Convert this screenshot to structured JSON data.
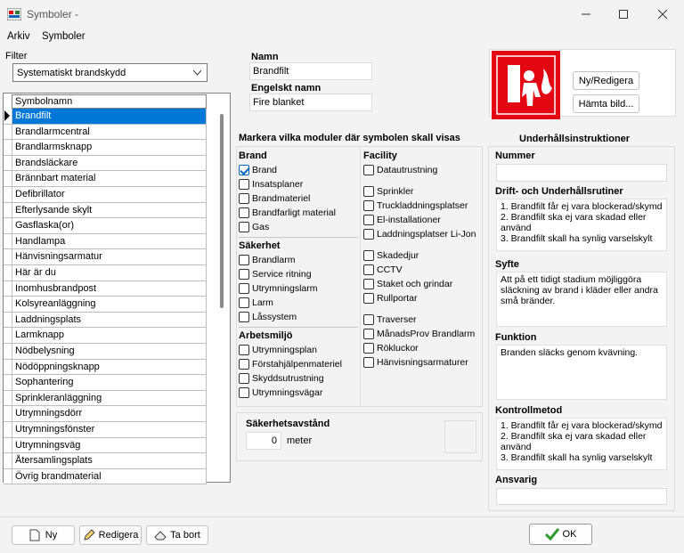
{
  "window": {
    "title": "Symboler -"
  },
  "menu": [
    "Arkiv",
    "Symboler"
  ],
  "filter": {
    "label": "Filter",
    "value": "Systematiskt brandskydd"
  },
  "list": {
    "header": "Symbolnamn",
    "items": [
      "Brandfilt",
      "Brandlarmcentral",
      "Brandlarmsknapp",
      "Brandsläckare",
      "Brännbart material",
      "Defibrillator",
      "Efterlysande skylt",
      "Gasflaska(or)",
      "Handlampa",
      "Hänvisningsarmatur",
      "Här är du",
      "Inomhusbrandpost",
      "Kolsyreanläggning",
      "Laddningsplats",
      "Larmknapp",
      "Nödbelysning",
      "Nödöppningsknapp",
      "Sophantering",
      "Sprinkleranläggning",
      "Utrymningsdörr",
      "Utrymningsfönster",
      "Utrymningsväg",
      "Återsamlingsplats",
      "Övrig brandmaterial"
    ],
    "selected_index": 0
  },
  "name": {
    "label": "Namn",
    "value": "Brandfilt"
  },
  "english_name": {
    "label": "Engelskt namn",
    "value": "Fire blanket"
  },
  "buttons": {
    "new_edit": "Ny/Redigera",
    "fetch_image": "Hämta bild...",
    "new": "Ny",
    "edit": "Redigera",
    "delete": "Ta bort",
    "ok": "OK"
  },
  "modules": {
    "heading": "Markera vilka moduler där symbolen skall visas",
    "brand": {
      "title": "Brand",
      "items": [
        {
          "label": "Brand",
          "checked": true
        },
        {
          "label": "Insatsplaner",
          "checked": false
        },
        {
          "label": "Brandmateriel",
          "checked": false
        },
        {
          "label": "Brandfarligt material",
          "checked": false
        },
        {
          "label": "Gas",
          "checked": false
        }
      ]
    },
    "sakerhet": {
      "title": "Säkerhet",
      "items": [
        {
          "label": "Brandlarm",
          "checked": false
        },
        {
          "label": "Service ritning",
          "checked": false
        },
        {
          "label": "Utrymningslarm",
          "checked": false
        },
        {
          "label": "Larm",
          "checked": false
        },
        {
          "label": "Låssystem",
          "checked": false
        }
      ]
    },
    "arbetsmiljo": {
      "title": "Arbetsmiljö",
      "items": [
        {
          "label": "Utrymningsplan",
          "checked": false
        },
        {
          "label": "Förstahjälpenmateriel",
          "checked": false
        },
        {
          "label": "Skyddsutrustning",
          "checked": false
        },
        {
          "label": "Utrymningsvägar",
          "checked": false
        }
      ]
    },
    "facility": {
      "title": "Facility",
      "groups": [
        [
          "Datautrustning"
        ],
        [
          "Sprinkler",
          "Truckladdningsplatser",
          "El-installationer",
          "Laddningsplatser Li-Jon"
        ],
        [
          "Skadedjur",
          "CCTV",
          "Staket och grindar",
          "Rullportar"
        ],
        [
          "Traverser",
          "MånadsProv Brandlarm",
          "Rökluckor",
          "Hänvisningsarmaturer"
        ]
      ]
    }
  },
  "safety_distance": {
    "label": "Säkerhetsavstånd",
    "value": "0",
    "unit": "meter"
  },
  "maintenance": {
    "heading": "Underhållsinstruktioner",
    "number": {
      "label": "Nummer",
      "value": ""
    },
    "routines": {
      "label": "Drift- och Underhållsrutiner",
      "value": "1. Brandfilt får ej vara blockerad/skymd\n2. Brandfilt ska ej vara skadad eller använd\n3. Brandfilt skall ha synlig varselskylt"
    },
    "purpose": {
      "label": "Syfte",
      "value": "Att på ett tidigt stadium möjliggöra släckning av brand i kläder eller andra små bränder."
    },
    "function": {
      "label": "Funktion",
      "value": "Branden släcks genom kvävning."
    },
    "control": {
      "label": "Kontrollmetod",
      "value": "1. Brandfilt får ej vara blockerad/skymd\n2. Brandfilt ska ej vara skadad eller använd\n3. Brandfilt skall ha synlig varselskylt"
    },
    "responsible": {
      "label": "Ansvarig",
      "value": ""
    }
  },
  "colors": {
    "accent": "#0078d7",
    "sign_red": "#e30613",
    "ok_check": "#2e9a2e"
  },
  "icons": [
    "app-icon",
    "minimize-icon",
    "maximize-icon",
    "close-icon",
    "chevron-down-icon",
    "row-pointer-icon",
    "fire-blanket-sign-icon",
    "new-document-icon",
    "pencil-icon",
    "eraser-icon",
    "checkmark-icon"
  ]
}
